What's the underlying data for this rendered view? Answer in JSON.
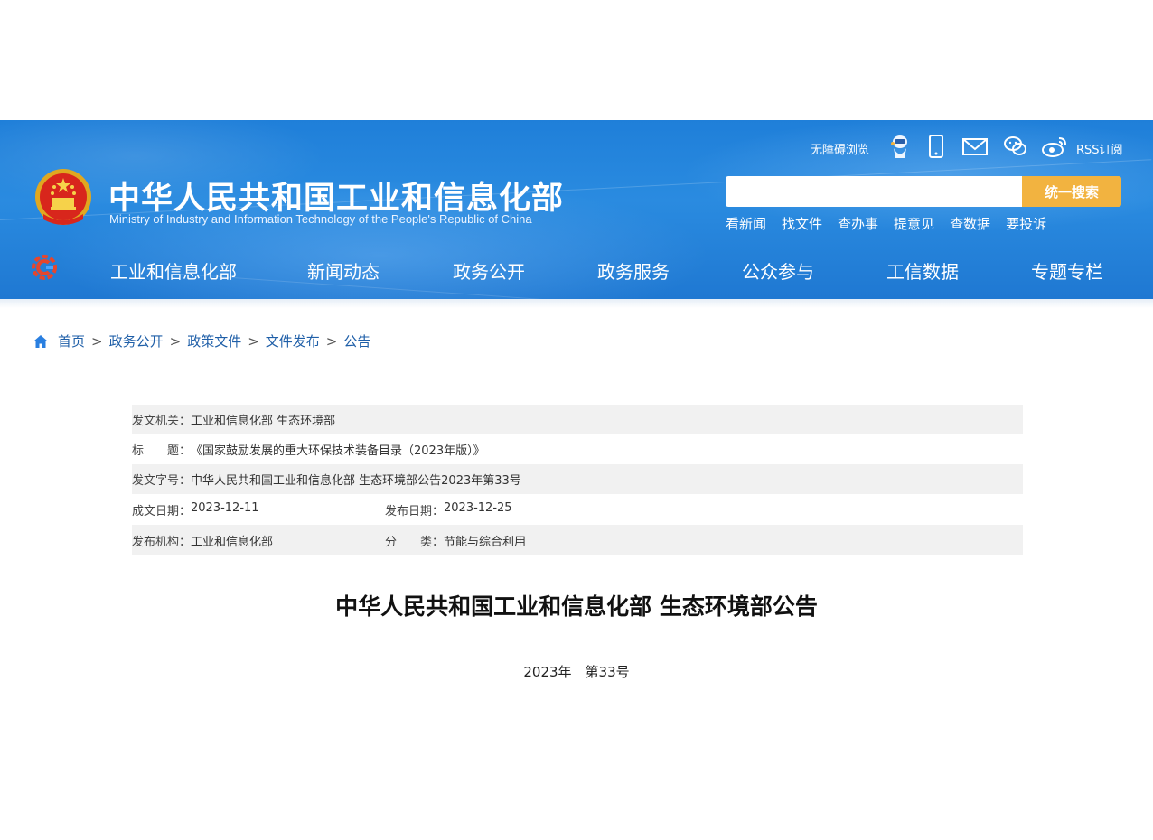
{
  "header": {
    "title_cn": "中华人民共和国工业和信息化部",
    "title_en": "Ministry of Industry and Information Technology of the People's Republic of China",
    "accessibility_label": "无障碍浏览",
    "rss_label": "RSS订阅",
    "search": {
      "placeholder": "",
      "button_label": "统一搜索"
    },
    "quick_links": [
      "看新闻",
      "找文件",
      "查办事",
      "提意见",
      "查数据",
      "要投诉"
    ],
    "nav": [
      "工业和信息化部",
      "新闻动态",
      "政务公开",
      "政务服务",
      "公众参与",
      "工信数据",
      "专题专栏"
    ],
    "icons": [
      "emblem-icon",
      "robot-icon",
      "mobile-icon",
      "mail-icon",
      "wechat-icon",
      "weibo-icon",
      "site-logo-icon"
    ]
  },
  "breadcrumb": [
    "首页",
    "政务公开",
    "政策文件",
    "文件发布",
    "公告"
  ],
  "breadcrumb_sep": ">",
  "meta": {
    "issuer_label": "发文机关：",
    "issuer": "工业和信息化部 生态环境部",
    "title_label": "标　　题：",
    "title": "《国家鼓励发展的重大环保技术装备目录（2023年版）》",
    "docno_label": "发文字号：",
    "docno": "中华人民共和国工业和信息化部 生态环境部公告2023年第33号",
    "written_label": "成文日期：",
    "written": "2023-12-11",
    "published_label": "发布日期：",
    "published": "2023-12-25",
    "org_label": "发布机构：",
    "org": "工业和信息化部",
    "category_label": "分　　类：",
    "category": "节能与综合利用"
  },
  "doc": {
    "title": "中华人民共和国工业和信息化部 生态环境部公告",
    "number": "2023年　第33号"
  },
  "colors": {
    "header_blue": "#2a8be0",
    "search_button": "#f2b340",
    "breadcrumb_link": "#1f5fa8",
    "row_shade": "#f1f1f1"
  }
}
